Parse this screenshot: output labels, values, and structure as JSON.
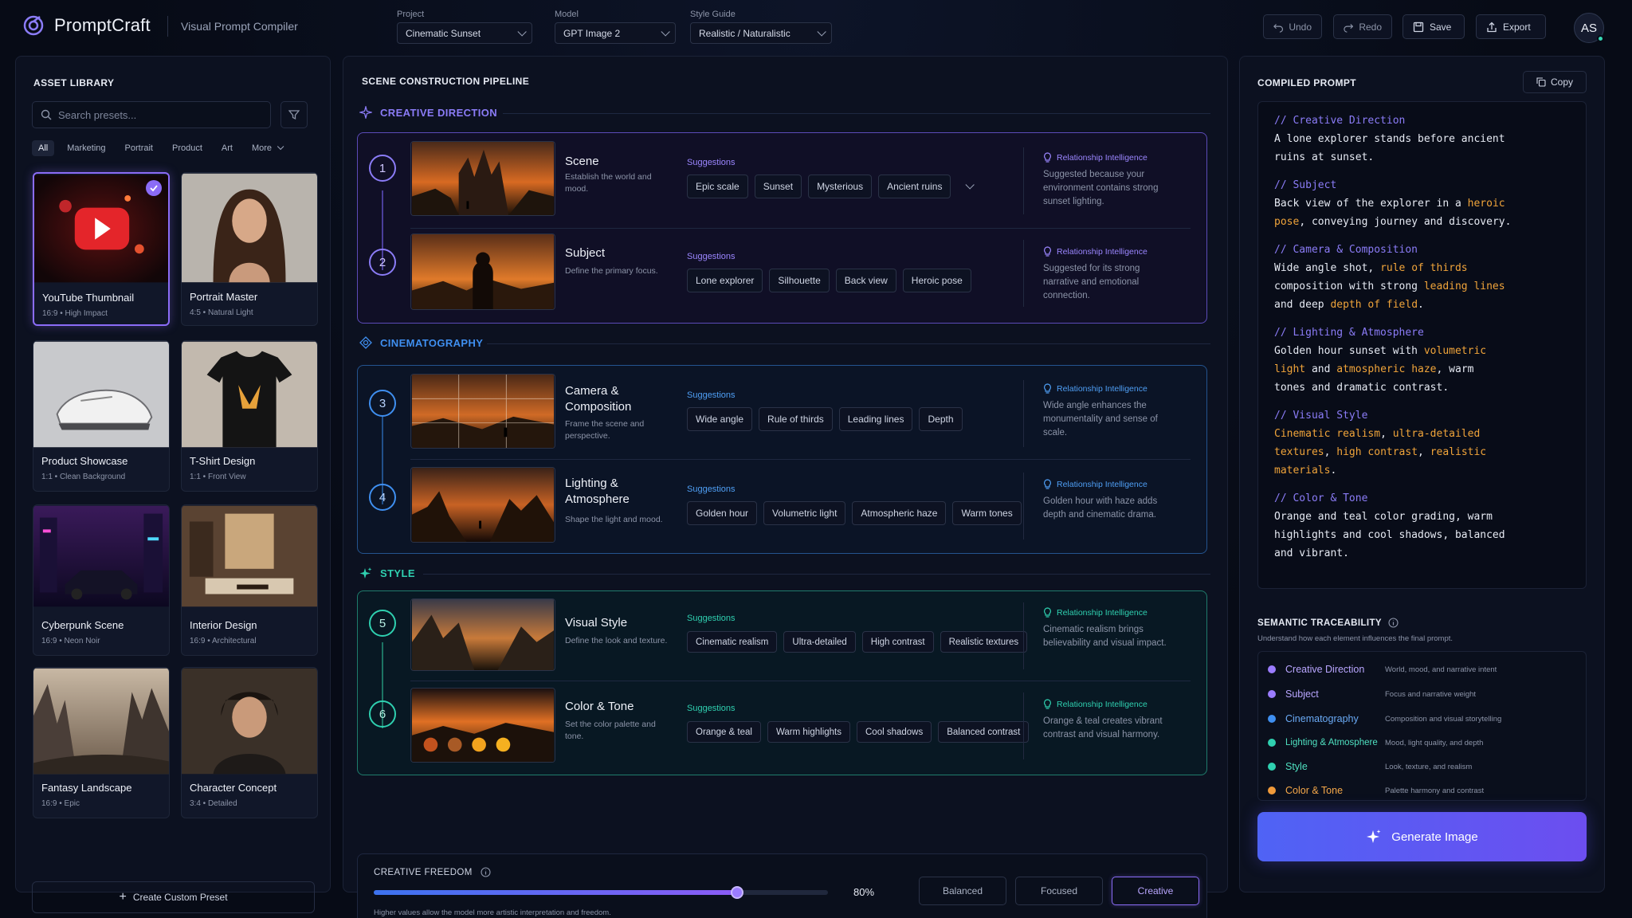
{
  "app": {
    "name": "PromptCraft",
    "subtitle": "Visual Prompt Compiler"
  },
  "header": {
    "project": {
      "label": "Project",
      "value": "Cinematic Sunset"
    },
    "model": {
      "label": "Model",
      "value": "GPT Image 2"
    },
    "style_guide": {
      "label": "Style Guide",
      "value": "Realistic / Naturalistic"
    },
    "undo": "Undo",
    "redo": "Redo",
    "save": "Save",
    "export": "Export",
    "avatar": "AS"
  },
  "asset_library": {
    "title": "ASSET LIBRARY",
    "search_placeholder": "Search presets...",
    "filters": [
      "All",
      "Marketing",
      "Portrait",
      "Product",
      "Art",
      "More"
    ],
    "cards": [
      {
        "title": "YouTube Thumbnail",
        "sub": "16:9 • High Impact",
        "selected": true
      },
      {
        "title": "Portrait Master",
        "sub": "4:5 • Natural Light"
      },
      {
        "title": "Product Showcase",
        "sub": "1:1 • Clean Background"
      },
      {
        "title": "T-Shirt Design",
        "sub": "1:1 • Front View"
      },
      {
        "title": "Cyberpunk Scene",
        "sub": "16:9 • Neon Noir"
      },
      {
        "title": "Interior Design",
        "sub": "16:9 • Architectural"
      },
      {
        "title": "Fantasy Landscape",
        "sub": "16:9 • Epic"
      },
      {
        "title": "Character Concept",
        "sub": "3:4 • Detailed"
      }
    ],
    "create_label": "Create Custom Preset"
  },
  "pipeline": {
    "title": "SCENE CONSTRUCTION PIPELINE",
    "sections": [
      {
        "name": "CREATIVE DIRECTION",
        "color": "#8b7cf7"
      },
      {
        "name": "CINEMATOGRAPHY",
        "color": "#3f8ff0"
      },
      {
        "name": "STYLE",
        "color": "#2fd0b0"
      }
    ],
    "suggestions_label": "Suggestions",
    "ri_label": "Relationship Intelligence",
    "steps": [
      {
        "num": "1",
        "title": "Scene",
        "desc": "Establish the world and mood.",
        "chips": [
          "Epic scale",
          "Sunset",
          "Mysterious",
          "Ancient ruins"
        ],
        "ri": "Suggested because your environment contains strong sunset lighting."
      },
      {
        "num": "2",
        "title": "Subject",
        "desc": "Define the primary focus.",
        "chips": [
          "Lone explorer",
          "Silhouette",
          "Back view",
          "Heroic pose"
        ],
        "ri": "Suggested for its strong narrative and emotional connection."
      },
      {
        "num": "3",
        "title": "Camera & Composition",
        "desc": "Frame the scene and perspective.",
        "chips": [
          "Wide angle",
          "Rule of thirds",
          "Leading lines",
          "Depth"
        ],
        "ri": "Wide angle enhances the monumentality and sense of scale."
      },
      {
        "num": "4",
        "title": "Lighting & Atmosphere",
        "desc": "Shape the light and mood.",
        "chips": [
          "Golden hour",
          "Volumetric light",
          "Atmospheric haze",
          "Warm tones"
        ],
        "ri": "Golden hour with haze adds depth and cinematic drama."
      },
      {
        "num": "5",
        "title": "Visual Style",
        "desc": "Define the look and texture.",
        "chips": [
          "Cinematic realism",
          "Ultra-detailed",
          "High contrast",
          "Realistic textures"
        ],
        "ri": "Cinematic realism brings believability and visual impact."
      },
      {
        "num": "6",
        "title": "Color & Tone",
        "desc": "Set the color palette and tone.",
        "chips": [
          "Orange & teal",
          "Warm highlights",
          "Cool shadows",
          "Balanced contrast"
        ],
        "ri": "Orange & teal creates vibrant contrast and visual harmony."
      }
    ],
    "creative_freedom": {
      "label": "CREATIVE FREEDOM",
      "value": 0.8,
      "value_text": "80%",
      "hint": "Higher values allow the model more artistic interpretation and freedom.",
      "modes": [
        "Balanced",
        "Focused",
        "Creative"
      ],
      "active_mode": "Creative"
    }
  },
  "compiled": {
    "title": "COMPILED PROMPT",
    "copy_label": "Copy",
    "trace_title": "SEMANTIC TRACEABILITY",
    "trace_sub": "Understand how each element influences the final prompt.",
    "trace": [
      {
        "name": "Creative Direction",
        "desc": "World, mood, and narrative intent",
        "color": "#9b7cff"
      },
      {
        "name": "Subject",
        "desc": "Focus and narrative weight",
        "color": "#9b7cff"
      },
      {
        "name": "Cinematography",
        "desc": "Composition and visual storytelling",
        "color": "#3f8ff0"
      },
      {
        "name": "Lighting & Atmosphere",
        "desc": "Mood, light quality, and depth",
        "color": "#2fd0b0"
      },
      {
        "name": "Style",
        "desc": "Look, texture, and realism",
        "color": "#2fd0b0"
      },
      {
        "name": "Color & Tone",
        "desc": "Palette harmony and contrast",
        "color": "#f09a3a"
      }
    ],
    "generate_label": "Generate Image"
  }
}
